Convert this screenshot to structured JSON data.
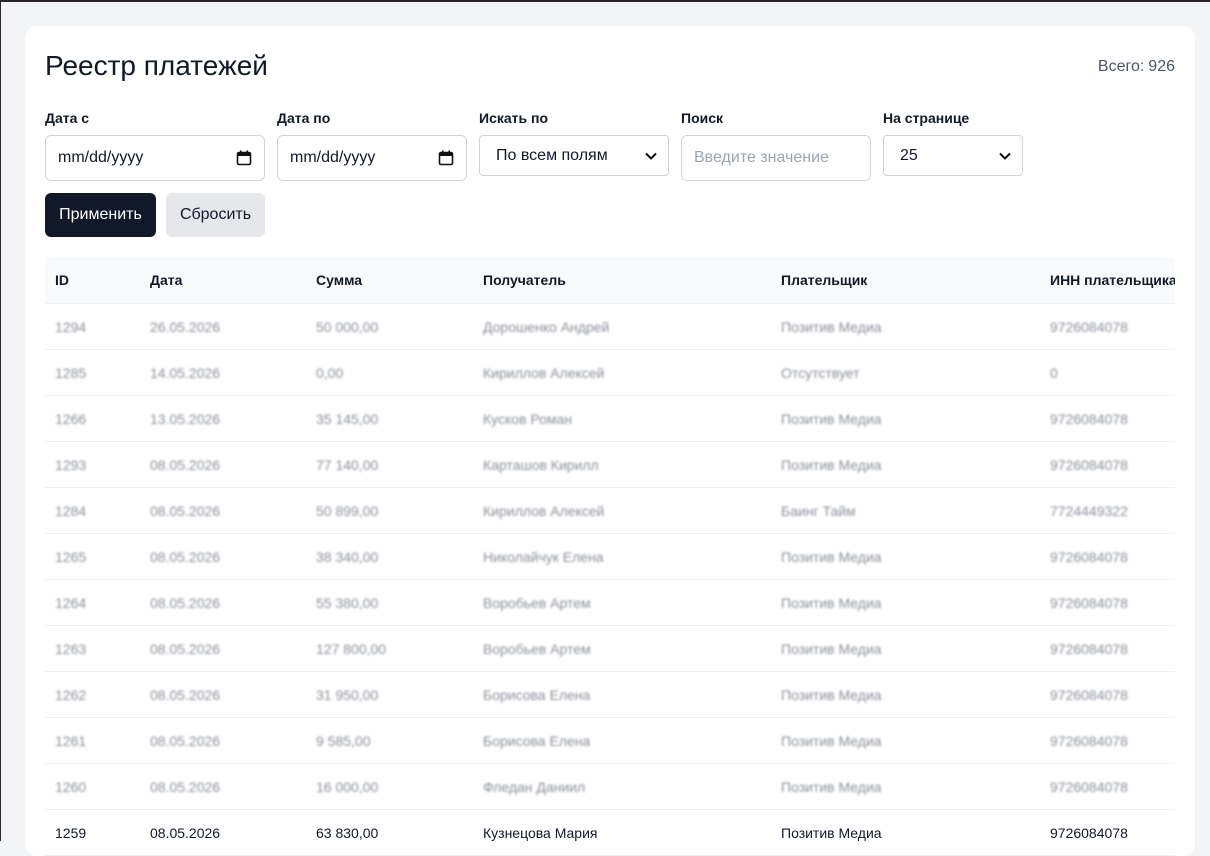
{
  "header": {
    "title": "Реестр платежей",
    "total_label": "Всего:",
    "total_value": "926"
  },
  "filters": {
    "date_from": {
      "label": "Дата с",
      "placeholder": "mm/dd/yyyy"
    },
    "date_to": {
      "label": "Дата по",
      "placeholder": "mm/dd/yyyy"
    },
    "search_by": {
      "label": "Искать по",
      "selected": "По всем полям"
    },
    "search": {
      "label": "Поиск",
      "placeholder": "Введите значение"
    },
    "per_page": {
      "label": "На странице",
      "selected": "25"
    }
  },
  "actions": {
    "apply_label": "Применить",
    "reset_label": "Сбросить"
  },
  "table": {
    "columns": [
      "ID",
      "Дата",
      "Сумма",
      "Получатель",
      "Плательщик",
      "ИНН плательщика"
    ],
    "rows": [
      {
        "id": "1294",
        "date": "26.05.2026",
        "amount": "50 000,00",
        "recipient": "Дорошенко Андрей",
        "payer": "Позитив Медиа",
        "inn": "9726084078",
        "blurred": true
      },
      {
        "id": "1285",
        "date": "14.05.2026",
        "amount": "0,00",
        "recipient": "Кириллов Алексей",
        "payer": "Отсутствует",
        "inn": "0",
        "blurred": true
      },
      {
        "id": "1266",
        "date": "13.05.2026",
        "amount": "35 145,00",
        "recipient": "Кусков Роман",
        "payer": "Позитив Медиа",
        "inn": "9726084078",
        "blurred": true
      },
      {
        "id": "1293",
        "date": "08.05.2026",
        "amount": "77 140,00",
        "recipient": "Карташов Кирилл",
        "payer": "Позитив Медиа",
        "inn": "9726084078",
        "blurred": true
      },
      {
        "id": "1284",
        "date": "08.05.2026",
        "amount": "50 899,00",
        "recipient": "Кириллов Алексей",
        "payer": "Баинг Тайм",
        "inn": "7724449322",
        "blurred": true
      },
      {
        "id": "1265",
        "date": "08.05.2026",
        "amount": "38 340,00",
        "recipient": "Николайчук Елена",
        "payer": "Позитив Медиа",
        "inn": "9726084078",
        "blurred": true
      },
      {
        "id": "1264",
        "date": "08.05.2026",
        "amount": "55 380,00",
        "recipient": "Воробьев Артем",
        "payer": "Позитив Медиа",
        "inn": "9726084078",
        "blurred": true
      },
      {
        "id": "1263",
        "date": "08.05.2026",
        "amount": "127 800,00",
        "recipient": "Воробьев Артем",
        "payer": "Позитив Медиа",
        "inn": "9726084078",
        "blurred": true
      },
      {
        "id": "1262",
        "date": "08.05.2026",
        "amount": "31 950,00",
        "recipient": "Борисова Елена",
        "payer": "Позитив Медиа",
        "inn": "9726084078",
        "blurred": true
      },
      {
        "id": "1261",
        "date": "08.05.2026",
        "amount": "9 585,00",
        "recipient": "Борисова Елена",
        "payer": "Позитив Медиа",
        "inn": "9726084078",
        "blurred": true
      },
      {
        "id": "1260",
        "date": "08.05.2026",
        "amount": "16 000,00",
        "recipient": "Фледан Даниил",
        "payer": "Позитив Медиа",
        "inn": "9726084078",
        "blurred": true
      },
      {
        "id": "1259",
        "date": "08.05.2026",
        "amount": "63 830,00",
        "recipient": "Кузнецова Мария",
        "payer": "Позитив Медиа",
        "inn": "9726084078",
        "blurred": false
      }
    ]
  }
}
